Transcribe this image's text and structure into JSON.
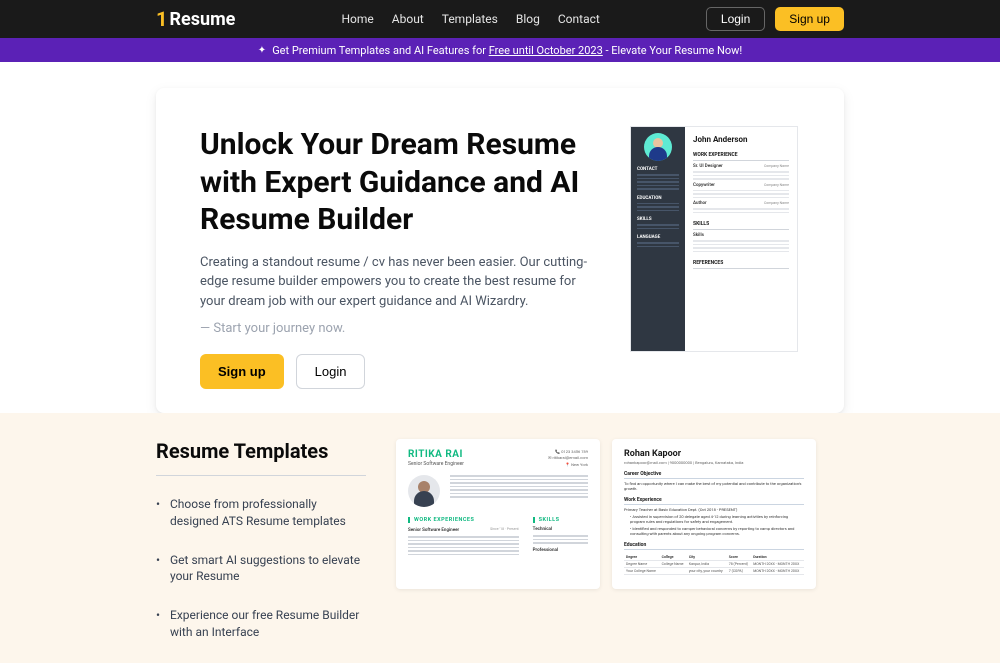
{
  "nav": {
    "logo": "Resume",
    "links": [
      "Home",
      "About",
      "Templates",
      "Blog",
      "Contact"
    ],
    "login": "Login",
    "signup": "Sign up"
  },
  "promo": {
    "prefix": "Get Premium Templates and AI Features for ",
    "link": "Free until October 2023",
    "suffix": " - Elevate Your Resume Now!"
  },
  "hero": {
    "title": "Unlock Your Dream Resume with Expert Guidance and AI Resume Builder",
    "sub": "Creating a standout resume / cv has never been easier. Our cutting-edge resume builder empowers you to create the best resume for your dream job with our expert guidance and AI Wizardry.",
    "tag": "— Start your journey now.",
    "signup": "Sign up",
    "login": "Login",
    "preview": {
      "name": "John Anderson",
      "sections_side": [
        "CONTACT",
        "EDUCATION",
        "SKILLS",
        "LANGUAGE"
      ],
      "sections_main": [
        {
          "h": "WORK EXPERIENCE",
          "items": [
            {
              "l": "Sr. UI Designer",
              "r": "Company Name"
            },
            {
              "l": "Copywriter",
              "r": "Company Name"
            },
            {
              "l": "Author",
              "r": "Company Name"
            }
          ]
        },
        {
          "h": "SKILLS",
          "items": [
            {
              "l": "Skills",
              "r": ""
            }
          ]
        },
        {
          "h": "REFERENCES",
          "items": []
        }
      ]
    }
  },
  "templates": {
    "title": "Resume Templates",
    "features": [
      "Choose from professionally designed ATS Resume templates",
      "Get smart AI suggestions to elevate your Resume",
      "Experience our free Resume Builder with an Interface"
    ],
    "card1": {
      "name": "RITIKA RAI",
      "role": "Senior Software Engineer",
      "contact": [
        "📞 0123 3456 789",
        "✉ ritikarai@email.com",
        "📍 New York"
      ],
      "sec1": "WORK EXPERIENCES",
      "sec1_job": "Senior Software Engineer",
      "sec1_meta": "Since '18 · Present",
      "sec2": "SKILLS",
      "sec2_sub": "Technical",
      "sec3": "Professional"
    },
    "card2": {
      "name": "Rohan Kapoor",
      "contact": "rohankapoor@mail.com | 9000000000 | Bengaluru, Karnataka, India",
      "sec1": "Career Objective",
      "sec1_txt": "To find an opportunity where I can make the best of my potential and contribute to the organization's growth.",
      "sec2": "Work Experience",
      "sec2_job": "Primary Teacher  at Basic Education Dept.  (Oct 2018 - PRESENT)",
      "sec2_b1": "Assisted in supervision of 20 delegate aged 4-12 during learning activities by reinforcing program rules and regulations for safety and engagement.",
      "sec2_b2": "Identified and responded to camper behavioral concerns by reporting to camp directors and consulting with parents about any ongoing program concerns.",
      "sec3": "Education",
      "table": {
        "head": [
          "Degree",
          "College",
          "City",
          "Score",
          "Duration"
        ],
        "rows": [
          [
            "Degree Name",
            "College Name",
            "Kanpur, India",
            "78 (Percent)",
            "MONTH 20XX - MONTH 20XX"
          ],
          [
            "Your College Name",
            "",
            "your city, your country",
            "7 (CGPA)",
            "MONTH 20XX - MONTH 20XX"
          ]
        ]
      }
    }
  }
}
